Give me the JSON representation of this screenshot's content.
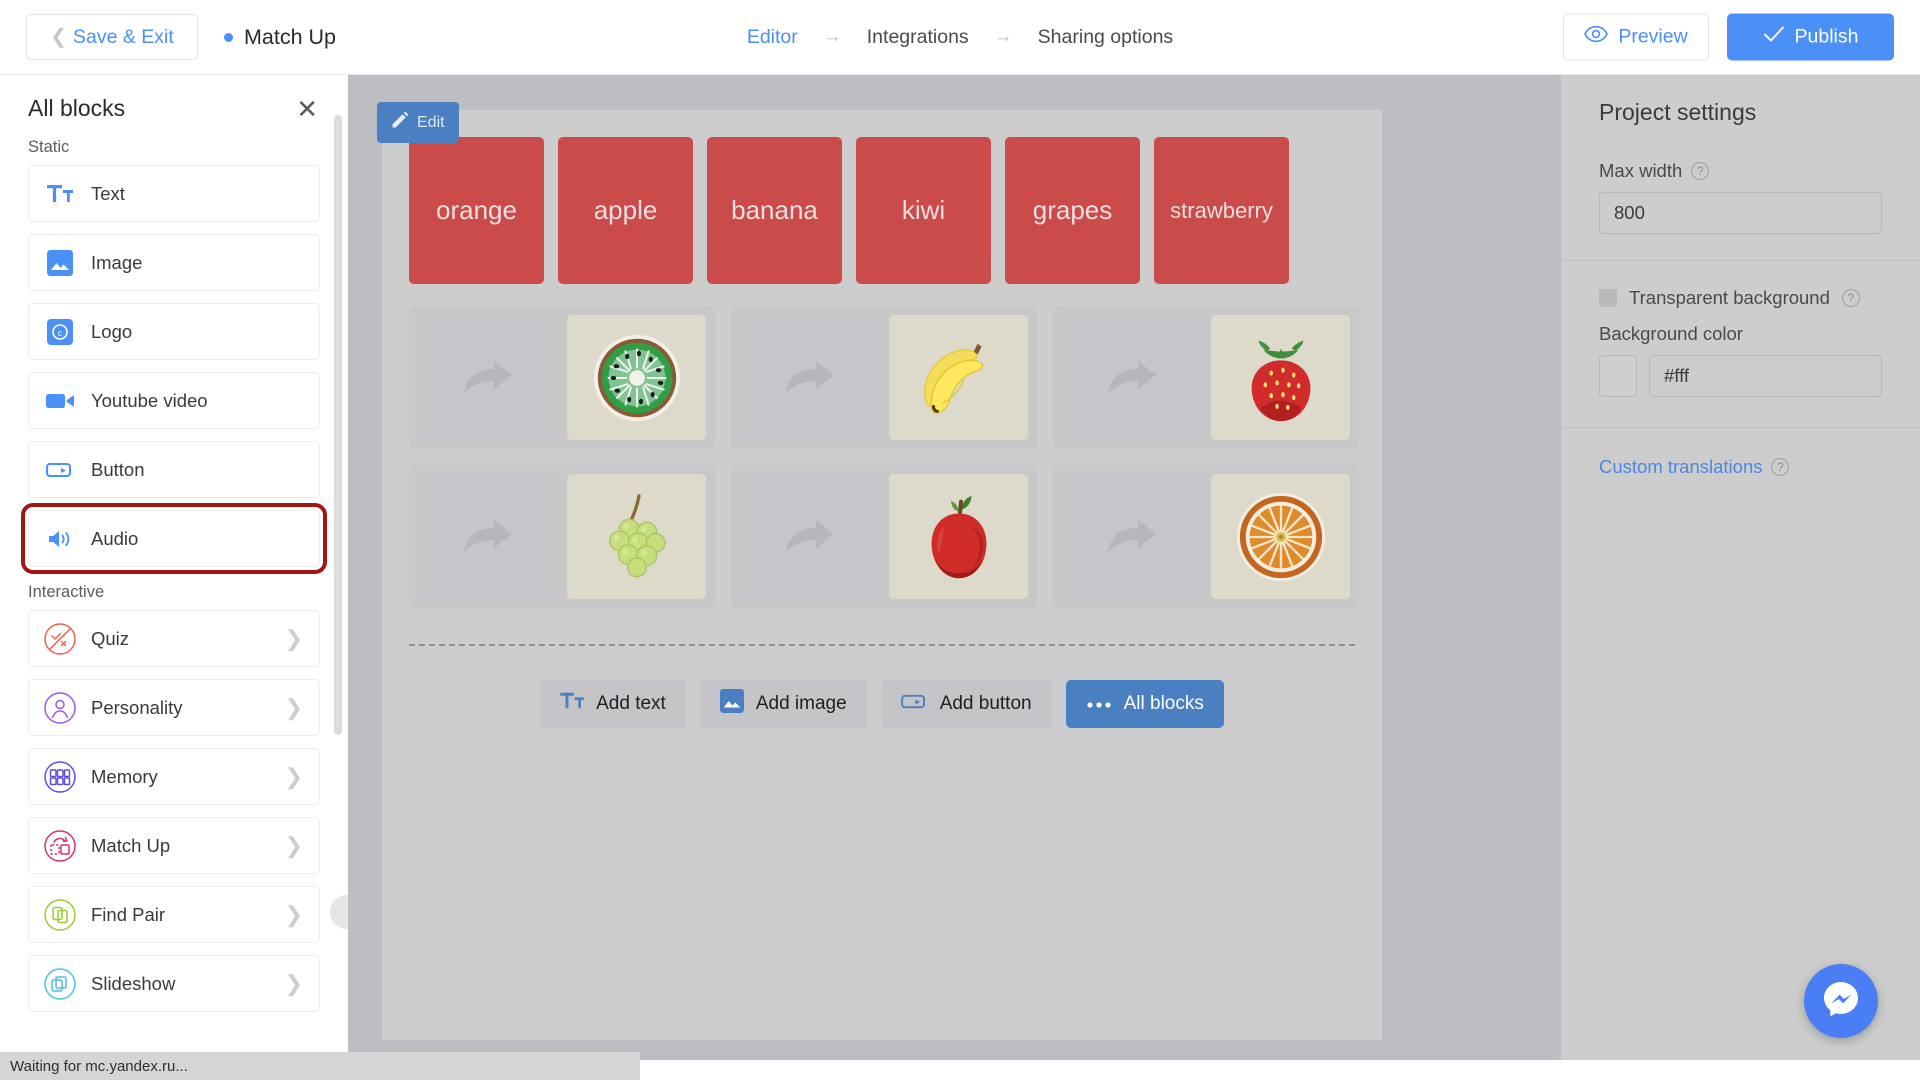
{
  "topbar": {
    "save_exit_label": "Save & Exit",
    "project_name": "Match Up",
    "breadcrumbs": [
      {
        "label": "Editor",
        "active": true
      },
      {
        "label": "Integrations",
        "active": false
      },
      {
        "label": "Sharing options",
        "active": false
      }
    ],
    "arrow": "→",
    "preview_label": "Preview",
    "publish_label": "Publish",
    "accent_color": "#4a90f7"
  },
  "left_panel": {
    "title": "All blocks",
    "close_icon": "close-icon",
    "sections": [
      {
        "title": "Static",
        "items": [
          {
            "label": "Text",
            "icon": "text-icon",
            "has_chevron": false,
            "highlighted": false
          },
          {
            "label": "Image",
            "icon": "image-icon",
            "has_chevron": false,
            "highlighted": false
          },
          {
            "label": "Logo",
            "icon": "logo-icon",
            "has_chevron": false,
            "highlighted": false
          },
          {
            "label": "Youtube video",
            "icon": "video-icon",
            "has_chevron": false,
            "highlighted": false
          },
          {
            "label": "Button",
            "icon": "button-icon",
            "has_chevron": false,
            "highlighted": false
          },
          {
            "label": "Audio",
            "icon": "audio-icon",
            "has_chevron": false,
            "highlighted": true
          }
        ]
      },
      {
        "title": "Interactive",
        "items": [
          {
            "label": "Quiz",
            "icon": "quiz-icon",
            "has_chevron": true,
            "highlighted": false,
            "color": "#f4604f"
          },
          {
            "label": "Personality",
            "icon": "personality-icon",
            "has_chevron": true,
            "highlighted": false,
            "color": "#9b59f0"
          },
          {
            "label": "Memory",
            "icon": "memory-icon",
            "has_chevron": true,
            "highlighted": false,
            "color": "#5b4fe0"
          },
          {
            "label": "Match Up",
            "icon": "matchup-icon",
            "has_chevron": true,
            "highlighted": false,
            "color": "#d6306f"
          },
          {
            "label": "Find Pair",
            "icon": "findpair-icon",
            "has_chevron": true,
            "highlighted": false,
            "color": "#99cc33"
          },
          {
            "label": "Slideshow",
            "icon": "slideshow-icon",
            "has_chevron": true,
            "highlighted": false,
            "color": "#4ebfe0"
          }
        ]
      }
    ],
    "highlight_color": "#a31515"
  },
  "canvas": {
    "edit_badge_label": "Edit",
    "word_cards": [
      {
        "label": "orange"
      },
      {
        "label": "apple"
      },
      {
        "label": "banana"
      },
      {
        "label": "kiwi"
      },
      {
        "label": "grapes"
      },
      {
        "label": "strawberry"
      }
    ],
    "card_color": "#cb4b4b",
    "pairs": [
      {
        "drop_icon": "drag-arrow-icon",
        "image": "kiwi-image"
      },
      {
        "drop_icon": "drag-arrow-icon",
        "image": "banana-image"
      },
      {
        "drop_icon": "drag-arrow-icon",
        "image": "strawberry-image"
      },
      {
        "drop_icon": "drag-arrow-icon",
        "image": "grapes-image"
      },
      {
        "drop_icon": "drag-arrow-icon",
        "image": "apple-image"
      },
      {
        "drop_icon": "drag-arrow-icon",
        "image": "orange-image"
      }
    ],
    "add_buttons": [
      {
        "label": "Add text",
        "icon": "text-icon",
        "primary": false
      },
      {
        "label": "Add image",
        "icon": "image-icon",
        "primary": false
      },
      {
        "label": "Add button",
        "icon": "button-icon",
        "primary": false
      },
      {
        "label": "All blocks",
        "icon": "ellipsis-icon",
        "primary": true
      }
    ]
  },
  "right_panel": {
    "title": "Project settings",
    "max_width_label": "Max width",
    "max_width_value": "800",
    "transparent_bg_label": "Transparent background",
    "transparent_bg_checked": false,
    "background_color_label": "Background color",
    "background_color_value": "#fff",
    "custom_translations_label": "Custom translations",
    "help_icon": "?"
  },
  "status_bar": {
    "text": "Waiting for mc.yandex.ru..."
  },
  "messenger": {
    "icon": "messenger-icon",
    "color": "#4a7ef5"
  }
}
